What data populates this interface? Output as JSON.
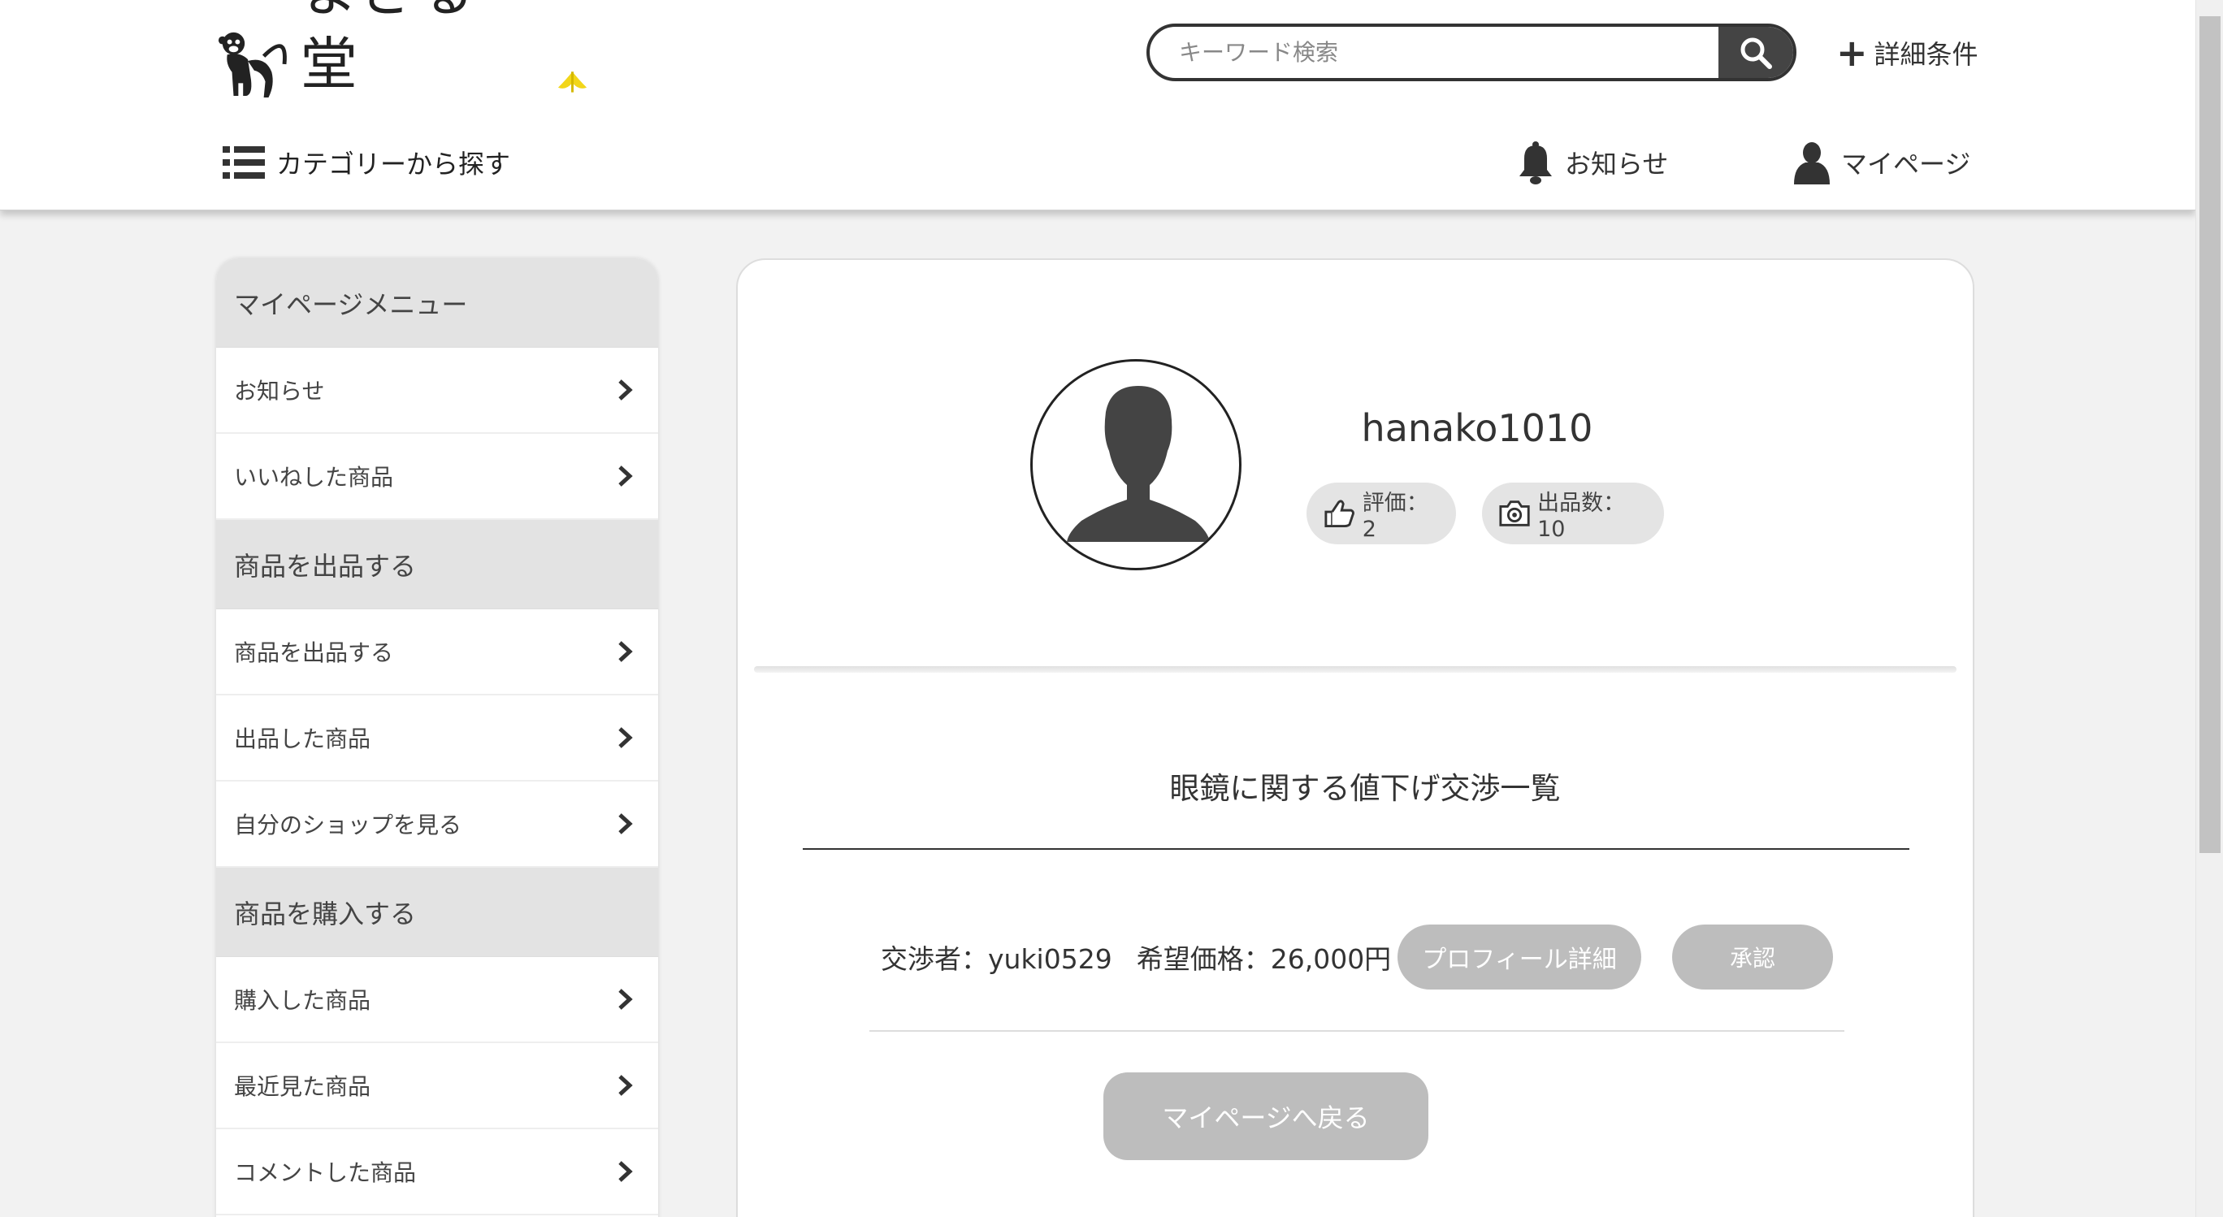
{
  "header": {
    "logo_text": "まさる堂",
    "search_placeholder": "キーワード検索",
    "detail_conditions": "詳細条件",
    "category_nav": "カテゴリーから探す",
    "notice_nav": "お知らせ",
    "mypage_nav": "マイページ"
  },
  "sidebar": {
    "sections": [
      {
        "head": "マイページメニュー",
        "items": [
          "お知らせ",
          "いいねした商品"
        ]
      },
      {
        "head": "商品を出品する",
        "items": [
          "商品を出品する",
          "出品した商品",
          "自分のショップを見る"
        ]
      },
      {
        "head": "商品を購入する",
        "items": [
          "購入した商品",
          "最近見た商品",
          "コメントした商品"
        ]
      }
    ]
  },
  "profile": {
    "username": "hanako1010",
    "rating": "評価：2",
    "listing_count": "出品数：10"
  },
  "negotiation": {
    "title": "眼鏡に関する値下げ交渉一覧",
    "negotiator": "交渉者：yuki0529",
    "desired_price": "希望価格：26,000円",
    "profile_button": "プロフィール詳細",
    "approve_button": "承認"
  },
  "back_button": "マイページへ戻る",
  "colors": {
    "logo_banana": "#f2d61a",
    "button_gray": "#bdbdbd",
    "search_button": "#444444"
  }
}
